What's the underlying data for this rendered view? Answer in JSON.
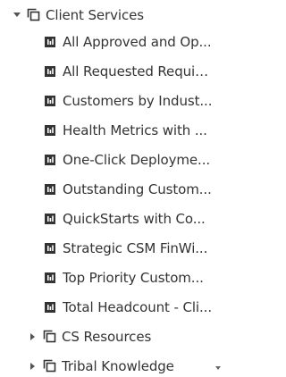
{
  "colors": {
    "text": "#333333",
    "icon": "#333333",
    "background": "#ffffff"
  },
  "tree": {
    "root": {
      "label": "Client Services",
      "icon": "folder-copy-icon",
      "expanded": true
    },
    "children": [
      {
        "label": "All Approved and Op...",
        "icon": "bar-chart-icon"
      },
      {
        "label": "All Requested Requis...",
        "icon": "bar-chart-icon"
      },
      {
        "label": "Customers by Indust...",
        "icon": "bar-chart-icon"
      },
      {
        "label": "Health Metrics with ...",
        "icon": "bar-chart-icon"
      },
      {
        "label": "One-Click Deployme...",
        "icon": "bar-chart-icon"
      },
      {
        "label": "Outstanding Custom...",
        "icon": "bar-chart-icon"
      },
      {
        "label": "QuickStarts with Co...",
        "icon": "bar-chart-icon"
      },
      {
        "label": "Strategic CSM FinWi...",
        "icon": "bar-chart-icon"
      },
      {
        "label": "Top Priority Custom...",
        "icon": "bar-chart-icon"
      },
      {
        "label": "Total Headcount - Cli...",
        "icon": "bar-chart-icon"
      }
    ],
    "folders": [
      {
        "label": "CS Resources",
        "icon": "folder-copy-icon",
        "expanded": false
      },
      {
        "label": "Tribal Knowledge",
        "icon": "folder-copy-icon",
        "expanded": false
      }
    ]
  }
}
